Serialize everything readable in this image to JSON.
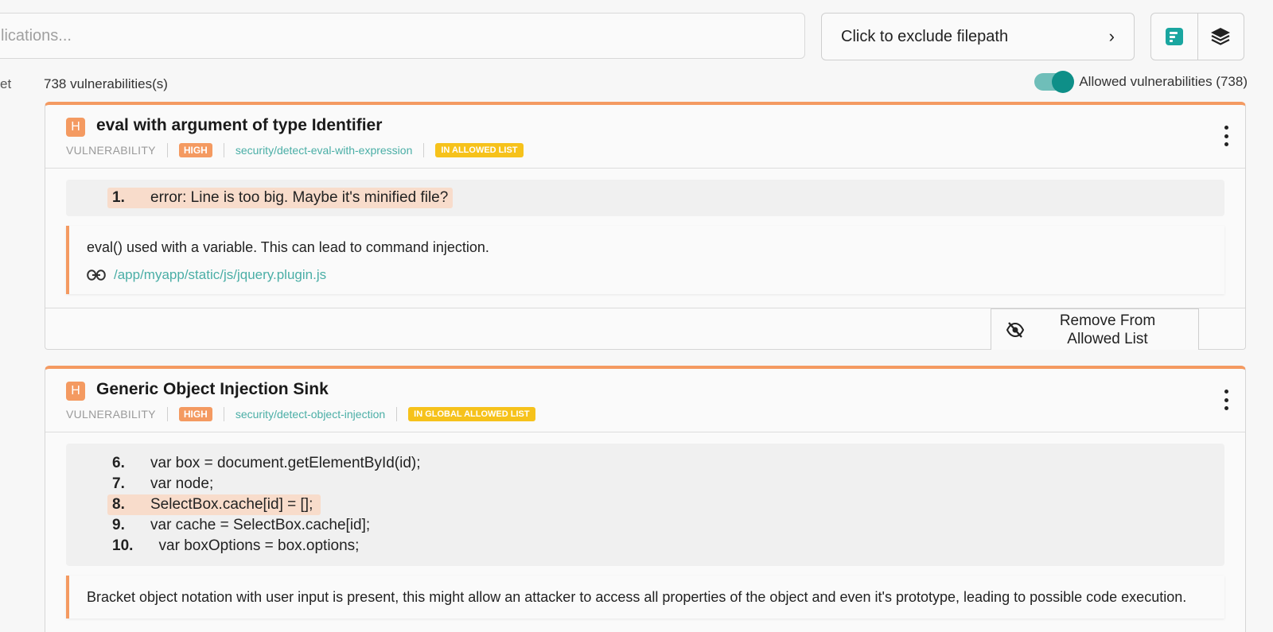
{
  "search": {
    "placeholder": "lications..."
  },
  "exclude": {
    "label": "Click to exclude filepath",
    "chevron": "›"
  },
  "view_buttons": [
    {
      "icon": "chart-bars-icon"
    },
    {
      "icon": "layers-icon"
    }
  ],
  "sidebar_fragment": "et",
  "summary": {
    "count_label": "738 vulnerabilities(s)",
    "toggle_label": "Allowed vulnerabilities (738)",
    "toggle_on": true
  },
  "colors": {
    "accent_orange": "#f49a61",
    "teal": "#0e8f88",
    "link_teal": "#4aaea6",
    "yellow": "#f6c21b"
  },
  "cards": [
    {
      "severity_letter": "H",
      "title": "eval with argument of type Identifier",
      "type": "VULNERABILITY",
      "severity": "HIGH",
      "rule": "security/detect-eval-with-expression",
      "list_badge": "IN ALLOWED LIST",
      "code": [
        {
          "num": "1.",
          "text": "error: Line is too big. Maybe it's minified file?",
          "highlight": true
        }
      ],
      "description": "eval() used with a variable. This can lead to command injection.",
      "file_link": "/app/myapp/static/js/jquery.plugin.js",
      "action_line1": "Remove From",
      "action_line2": "Allowed List"
    },
    {
      "severity_letter": "H",
      "title": "Generic Object Injection Sink",
      "type": "VULNERABILITY",
      "severity": "HIGH",
      "rule": "security/detect-object-injection",
      "list_badge": "IN GLOBAL ALLOWED LIST",
      "code": [
        {
          "num": "6.",
          "text": "var box = document.getElementById(id);",
          "highlight": false
        },
        {
          "num": "7.",
          "text": "var node;",
          "highlight": false
        },
        {
          "num": "8.",
          "text": "SelectBox.cache[id] = [];",
          "highlight": true
        },
        {
          "num": "9.",
          "text": "var cache = SelectBox.cache[id];",
          "highlight": false
        },
        {
          "num": "10.",
          "text": "  var boxOptions = box.options;",
          "highlight": false
        }
      ],
      "description": "Bracket object notation with user input is present, this might allow an attacker to access all properties of the object and even it's prototype, leading to possible code execution."
    }
  ]
}
